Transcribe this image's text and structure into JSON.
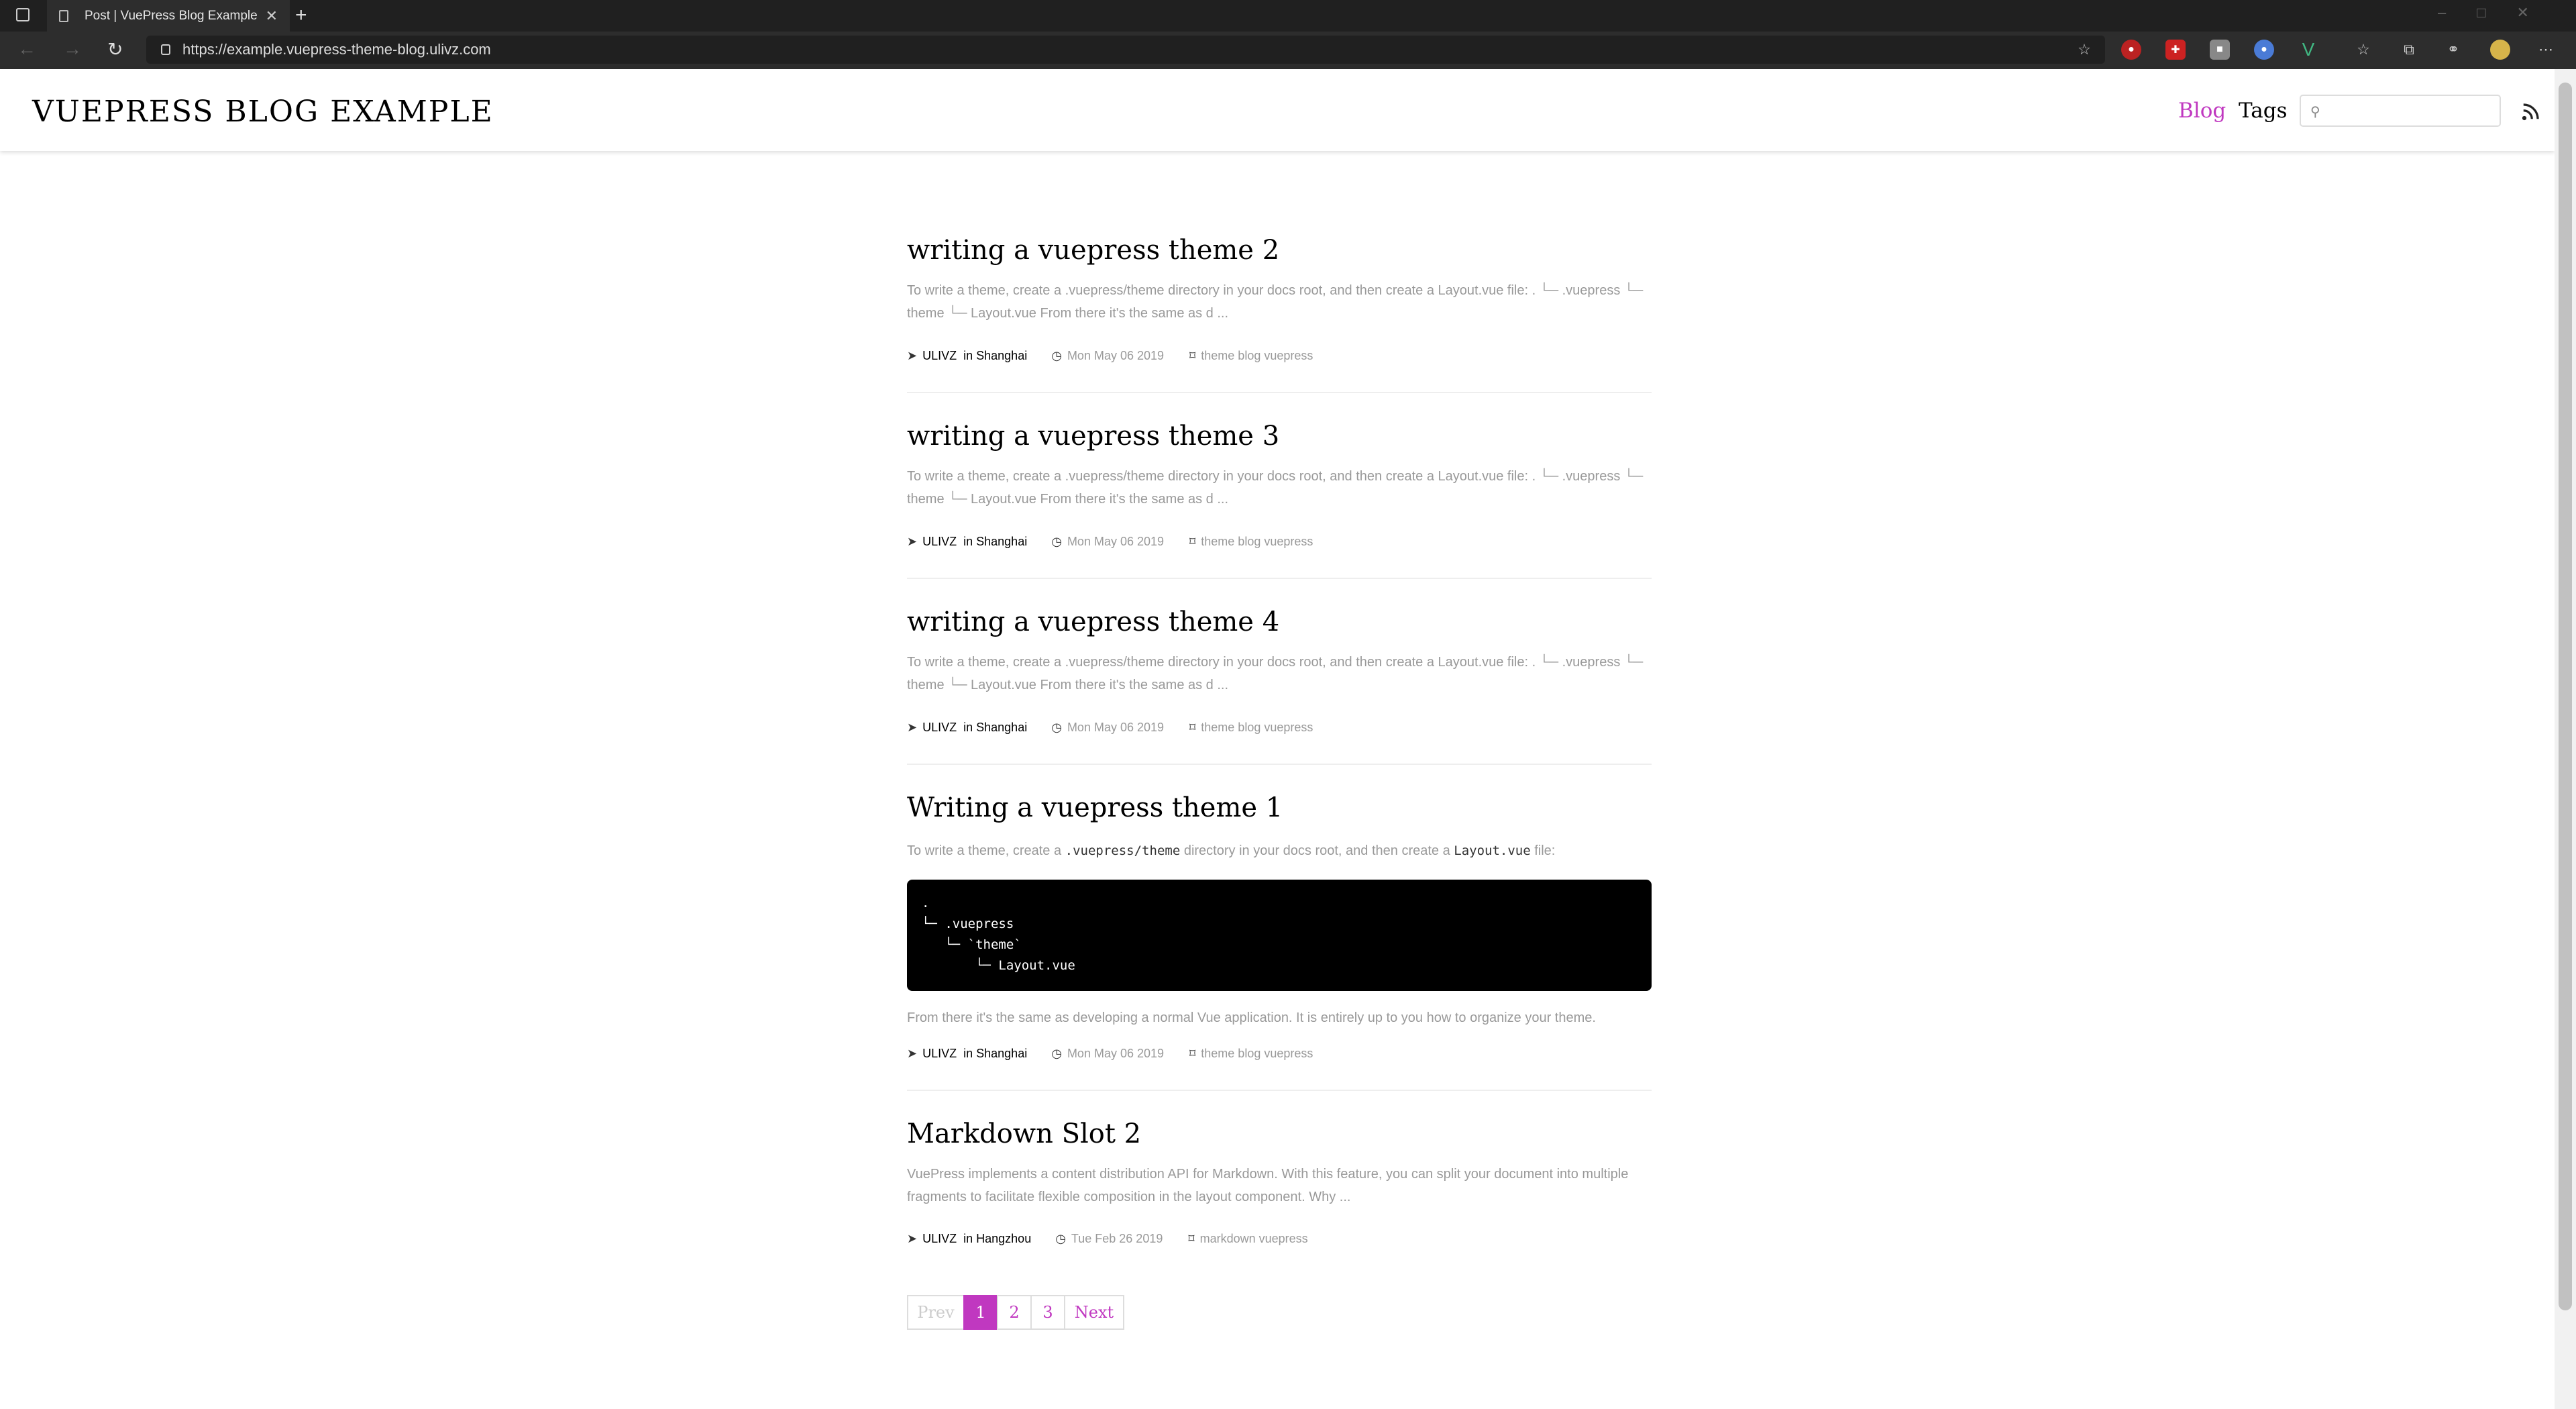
{
  "browser": {
    "tab_title": "Post | VuePress Blog Example",
    "url": "https://example.vuepress-theme-blog.ulivz.com"
  },
  "site": {
    "title": "VUEPRESS BLOG EXAMPLE",
    "nav": [
      {
        "label": "Blog",
        "active": true
      },
      {
        "label": "Tags",
        "active": false
      }
    ],
    "search_placeholder": "",
    "accent_color": "#c038c0"
  },
  "posts": [
    {
      "title": "writing a vuepress theme 2",
      "summary_line1": "To write a theme, create a .vuepress/theme directory in your docs root, and then create a Layout.vue file: . └─ .vuepress └─",
      "summary_line2": "theme └─ Layout.vue From there it's the same as d ...",
      "author": "ULIVZ",
      "location": "in Shanghai",
      "date": "Mon May 06 2019",
      "tags": "theme blog vuepress"
    },
    {
      "title": "writing a vuepress theme 3",
      "summary_line1": "To write a theme, create a .vuepress/theme directory in your docs root, and then create a Layout.vue file: . └─ .vuepress └─",
      "summary_line2": "theme └─ Layout.vue From there it's the same as d ...",
      "author": "ULIVZ",
      "location": "in Shanghai",
      "date": "Mon May 06 2019",
      "tags": "theme blog vuepress"
    },
    {
      "title": "writing a vuepress theme 4",
      "summary_line1": "To write a theme, create a .vuepress/theme directory in your docs root, and then create a Layout.vue file: . └─ .vuepress └─",
      "summary_line2": "theme └─ Layout.vue From there it's the same as d ...",
      "author": "ULIVZ",
      "location": "in Shanghai",
      "date": "Mon May 06 2019",
      "tags": "theme blog vuepress"
    },
    {
      "title": "Writing a vuepress theme 1",
      "intro_a": "To write a theme, create a ",
      "intro_code1": ".vuepress/theme",
      "intro_b": " directory in your docs root, and then create a ",
      "intro_code2": "Layout.vue",
      "intro_c": " file:",
      "code": ".\n└─ .vuepress\n   └─ `theme`\n       └─ Layout.vue",
      "after": "From there it's the same as developing a normal Vue application. It is entirely up to you how to organize your theme.",
      "author": "ULIVZ",
      "location": "in Shanghai",
      "date": "Mon May 06 2019",
      "tags": "theme blog vuepress"
    },
    {
      "title": "Markdown Slot 2",
      "summary_line1": "VuePress implements a content distribution API for Markdown. With this feature, you can split your document into multiple",
      "summary_line2": "fragments to facilitate flexible composition in the layout component. Why ...",
      "author": "ULIVZ",
      "location": "in Hangzhou",
      "date": "Tue Feb 26 2019",
      "tags": "markdown vuepress"
    }
  ],
  "pagination": {
    "prev": "Prev",
    "pages": [
      "1",
      "2",
      "3"
    ],
    "current": "1",
    "next": "Next"
  }
}
